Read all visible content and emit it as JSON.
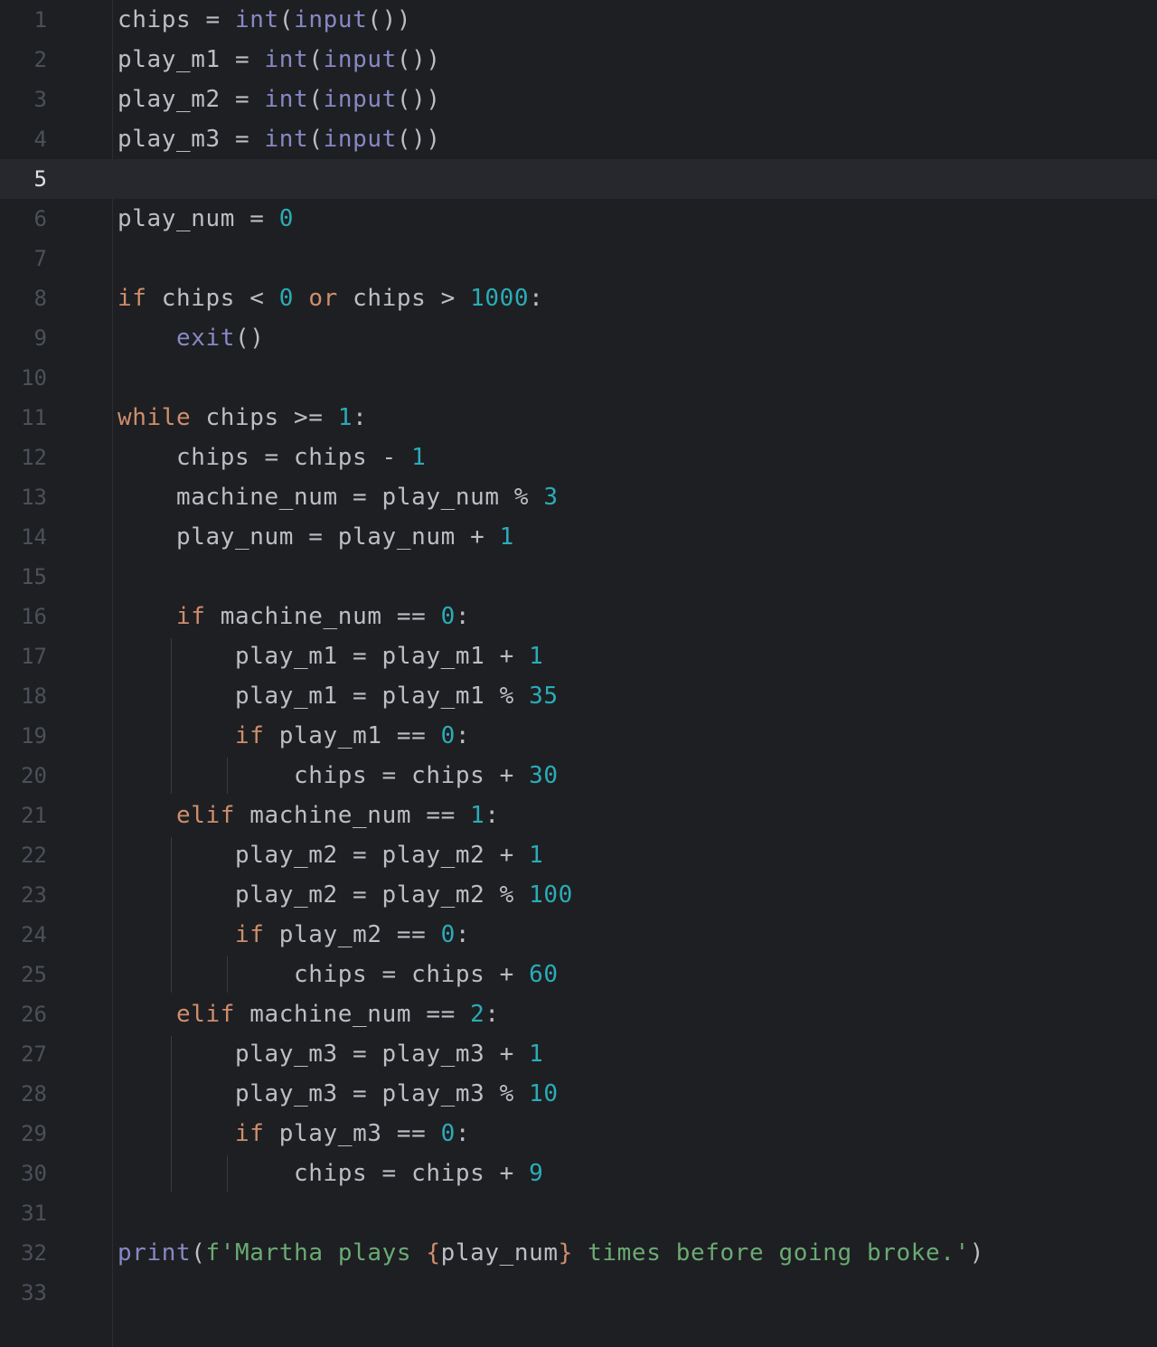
{
  "editor": {
    "current_line": 5,
    "lines": [
      [
        {
          "t": "chips = ",
          "c": "txt"
        },
        {
          "t": "int",
          "c": "bi"
        },
        {
          "t": "(",
          "c": "txt"
        },
        {
          "t": "input",
          "c": "bi"
        },
        {
          "t": "())",
          "c": "txt"
        }
      ],
      [
        {
          "t": "play_m1 = ",
          "c": "txt"
        },
        {
          "t": "int",
          "c": "bi"
        },
        {
          "t": "(",
          "c": "txt"
        },
        {
          "t": "input",
          "c": "bi"
        },
        {
          "t": "())",
          "c": "txt"
        }
      ],
      [
        {
          "t": "play_m2 = ",
          "c": "txt"
        },
        {
          "t": "int",
          "c": "bi"
        },
        {
          "t": "(",
          "c": "txt"
        },
        {
          "t": "input",
          "c": "bi"
        },
        {
          "t": "())",
          "c": "txt"
        }
      ],
      [
        {
          "t": "play_m3 = ",
          "c": "txt"
        },
        {
          "t": "int",
          "c": "bi"
        },
        {
          "t": "(",
          "c": "txt"
        },
        {
          "t": "input",
          "c": "bi"
        },
        {
          "t": "())",
          "c": "txt"
        }
      ],
      [],
      [
        {
          "t": "play_num = ",
          "c": "txt"
        },
        {
          "t": "0",
          "c": "num"
        }
      ],
      [],
      [
        {
          "t": "if",
          "c": "kw"
        },
        {
          "t": " chips < ",
          "c": "txt"
        },
        {
          "t": "0",
          "c": "num"
        },
        {
          "t": " ",
          "c": "txt"
        },
        {
          "t": "or",
          "c": "kw"
        },
        {
          "t": " chips > ",
          "c": "txt"
        },
        {
          "t": "1000",
          "c": "num"
        },
        {
          "t": ":",
          "c": "txt"
        }
      ],
      [
        {
          "t": "    ",
          "c": "txt"
        },
        {
          "t": "exit",
          "c": "bi"
        },
        {
          "t": "()",
          "c": "txt"
        }
      ],
      [],
      [
        {
          "t": "while",
          "c": "kw"
        },
        {
          "t": " chips >= ",
          "c": "txt"
        },
        {
          "t": "1",
          "c": "num"
        },
        {
          "t": ":",
          "c": "txt"
        }
      ],
      [
        {
          "t": "    chips = chips - ",
          "c": "txt"
        },
        {
          "t": "1",
          "c": "num"
        }
      ],
      [
        {
          "t": "    machine_num = play_num % ",
          "c": "txt"
        },
        {
          "t": "3",
          "c": "num"
        }
      ],
      [
        {
          "t": "    play_num = play_num + ",
          "c": "txt"
        },
        {
          "t": "1",
          "c": "num"
        }
      ],
      [],
      [
        {
          "t": "    ",
          "c": "txt"
        },
        {
          "t": "if",
          "c": "kw"
        },
        {
          "t": " machine_num == ",
          "c": "txt"
        },
        {
          "t": "0",
          "c": "num"
        },
        {
          "t": ":",
          "c": "txt"
        }
      ],
      [
        {
          "t": "        play_m1 = play_m1 + ",
          "c": "txt"
        },
        {
          "t": "1",
          "c": "num"
        }
      ],
      [
        {
          "t": "        play_m1 = play_m1 % ",
          "c": "txt"
        },
        {
          "t": "35",
          "c": "num"
        }
      ],
      [
        {
          "t": "        ",
          "c": "txt"
        },
        {
          "t": "if",
          "c": "kw"
        },
        {
          "t": " play_m1 == ",
          "c": "txt"
        },
        {
          "t": "0",
          "c": "num"
        },
        {
          "t": ":",
          "c": "txt"
        }
      ],
      [
        {
          "t": "            chips = chips + ",
          "c": "txt"
        },
        {
          "t": "30",
          "c": "num"
        }
      ],
      [
        {
          "t": "    ",
          "c": "txt"
        },
        {
          "t": "elif",
          "c": "kw"
        },
        {
          "t": " machine_num == ",
          "c": "txt"
        },
        {
          "t": "1",
          "c": "num"
        },
        {
          "t": ":",
          "c": "txt"
        }
      ],
      [
        {
          "t": "        play_m2 = play_m2 + ",
          "c": "txt"
        },
        {
          "t": "1",
          "c": "num"
        }
      ],
      [
        {
          "t": "        play_m2 = play_m2 % ",
          "c": "txt"
        },
        {
          "t": "100",
          "c": "num"
        }
      ],
      [
        {
          "t": "        ",
          "c": "txt"
        },
        {
          "t": "if",
          "c": "kw"
        },
        {
          "t": " play_m2 == ",
          "c": "txt"
        },
        {
          "t": "0",
          "c": "num"
        },
        {
          "t": ":",
          "c": "txt"
        }
      ],
      [
        {
          "t": "            chips = chips + ",
          "c": "txt"
        },
        {
          "t": "60",
          "c": "num"
        }
      ],
      [
        {
          "t": "    ",
          "c": "txt"
        },
        {
          "t": "elif",
          "c": "kw"
        },
        {
          "t": " machine_num == ",
          "c": "txt"
        },
        {
          "t": "2",
          "c": "num"
        },
        {
          "t": ":",
          "c": "txt"
        }
      ],
      [
        {
          "t": "        play_m3 = play_m3 + ",
          "c": "txt"
        },
        {
          "t": "1",
          "c": "num"
        }
      ],
      [
        {
          "t": "        play_m3 = play_m3 % ",
          "c": "txt"
        },
        {
          "t": "10",
          "c": "num"
        }
      ],
      [
        {
          "t": "        ",
          "c": "txt"
        },
        {
          "t": "if",
          "c": "kw"
        },
        {
          "t": " play_m3 == ",
          "c": "txt"
        },
        {
          "t": "0",
          "c": "num"
        },
        {
          "t": ":",
          "c": "txt"
        }
      ],
      [
        {
          "t": "            chips = chips + ",
          "c": "txt"
        },
        {
          "t": "9",
          "c": "num"
        }
      ],
      [],
      [
        {
          "t": "print",
          "c": "bi"
        },
        {
          "t": "(",
          "c": "txt"
        },
        {
          "t": "f'Martha plays ",
          "c": "str"
        },
        {
          "t": "{",
          "c": "brace"
        },
        {
          "t": "play_num",
          "c": "txt"
        },
        {
          "t": "}",
          "c": "brace"
        },
        {
          "t": " times before going broke.'",
          "c": "str"
        },
        {
          "t": ")",
          "c": "txt"
        }
      ],
      []
    ]
  }
}
